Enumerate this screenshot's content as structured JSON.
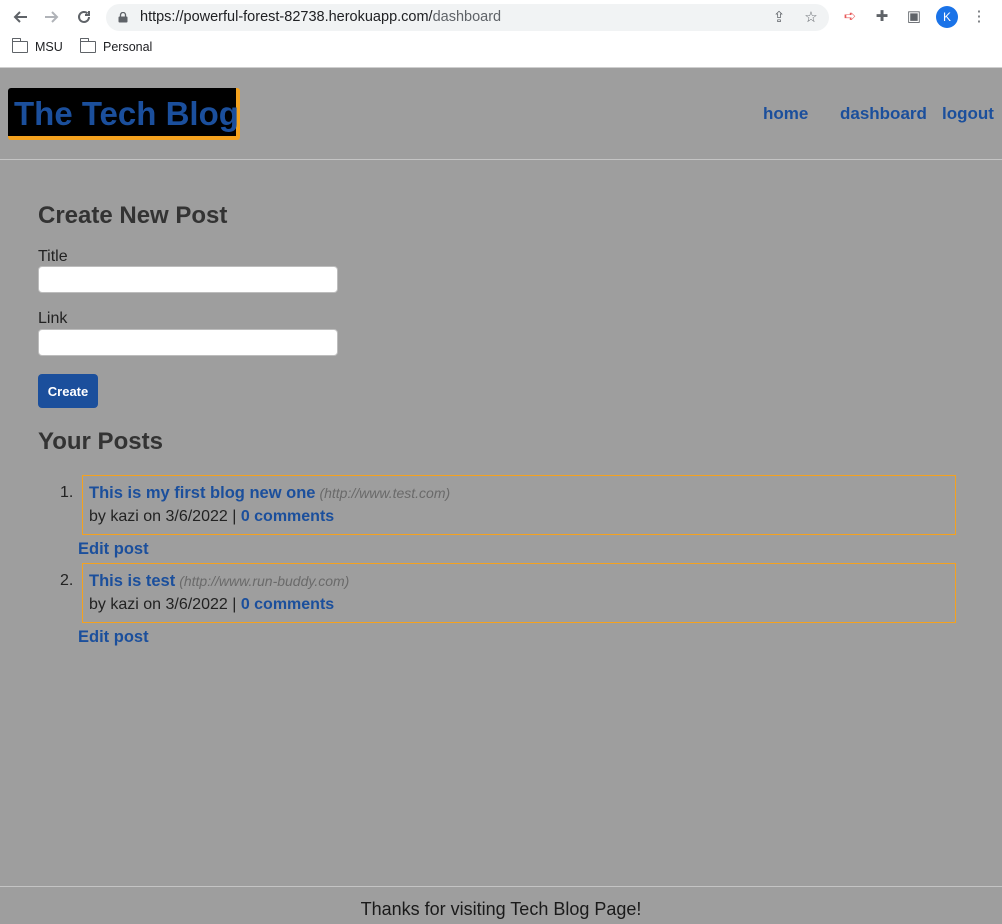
{
  "browser": {
    "url_host": "https://powerful-forest-82738.herokuapp.com/",
    "url_path": "dashboard",
    "avatar_letter": "K",
    "bookmarks": [
      "MSU",
      "Personal"
    ]
  },
  "header": {
    "logo": "The Tech Blog",
    "nav": [
      "home",
      "dashboard",
      "logout"
    ]
  },
  "create": {
    "heading": "Create New Post",
    "title_label": "Title",
    "title_value": "",
    "link_label": "Link",
    "link_value": "",
    "button": "Create"
  },
  "posts": {
    "heading": "Your Posts",
    "items": [
      {
        "num": "1.",
        "title": "This is my first blog new one",
        "link": "(http://www.test.com)",
        "meta": "by kazi on 3/6/2022 | ",
        "comments": "0 comments",
        "edit": "Edit post"
      },
      {
        "num": "2.",
        "title": "This is test",
        "link": "(http://www.run-buddy.com)",
        "meta": "by kazi on 3/6/2022 | ",
        "comments": "0 comments",
        "edit": "Edit post"
      }
    ]
  },
  "footer": {
    "text": "Thanks for visiting Tech Blog Page!"
  },
  "colors": {
    "accent": "#1b4f9c",
    "border": "#f4a21f",
    "background": "#9e9e9e"
  }
}
